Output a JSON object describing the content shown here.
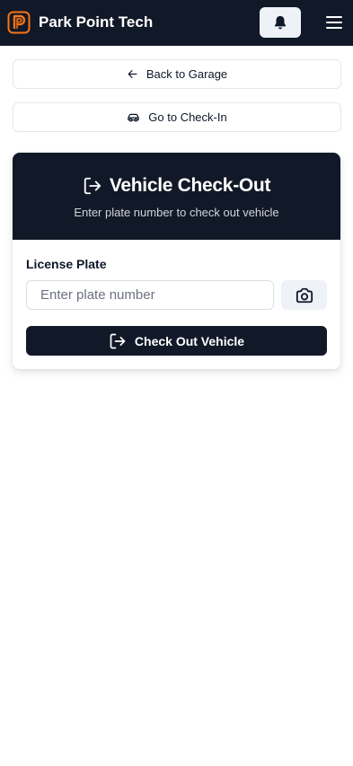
{
  "header": {
    "app_title": "Park Point Tech",
    "logo_icon": "park-point-logo-icon",
    "notifications_icon": "bell-icon",
    "menu_icon": "hamburger-menu-icon"
  },
  "nav": {
    "back_label": "Back to Garage",
    "back_icon": "arrow-left-icon",
    "checkin_label": "Go to Check-In",
    "checkin_icon": "car-icon"
  },
  "checkout_card": {
    "title": "Vehicle Check-Out",
    "title_icon": "log-out-icon",
    "subtitle": "Enter plate number to check out vehicle",
    "license_label": "License Plate",
    "plate_value": "",
    "plate_placeholder": "Enter plate number",
    "camera_icon": "camera-icon",
    "submit_label": "Check Out Vehicle",
    "submit_icon": "log-out-icon"
  },
  "colors": {
    "header_bg": "#111827",
    "brand_orange": "#f97316",
    "light_button_bg": "#eef2f7",
    "border": "#e2e8f0"
  }
}
